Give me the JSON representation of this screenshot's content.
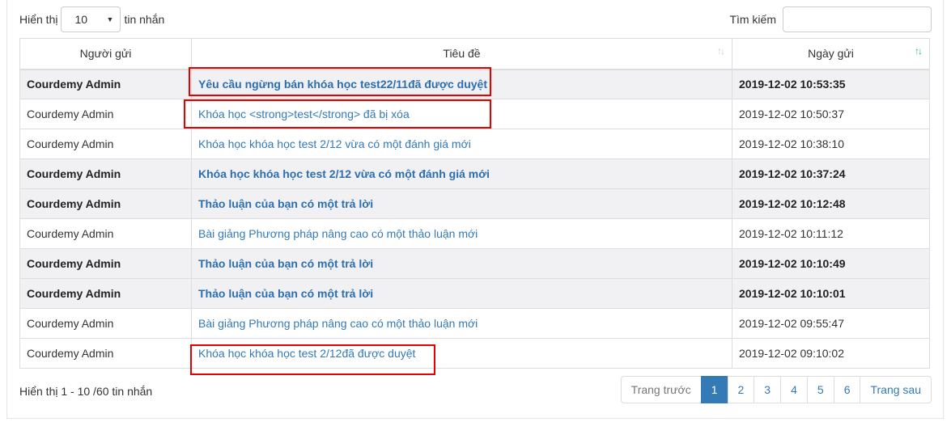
{
  "length_menu": {
    "prefix": "Hiển thị",
    "value": "10",
    "suffix": "tin nhắn"
  },
  "search": {
    "label": "Tìm kiếm",
    "value": "",
    "placeholder": ""
  },
  "table": {
    "columns": [
      "Người gửi",
      "Tiêu đề",
      "Ngày gửi"
    ],
    "rows": [
      {
        "sender": "Courdemy Admin",
        "subject": "Yêu cầu ngừng bán khóa học test22/11đã được duyệt",
        "date": "2019-12-02 10:53:35",
        "unread": true
      },
      {
        "sender": "Courdemy Admin",
        "subject": "Khóa học <strong>test</strong> đã bị xóa",
        "date": "2019-12-02 10:50:37",
        "unread": false
      },
      {
        "sender": "Courdemy Admin",
        "subject": "Khóa học khóa học test 2/12 vừa có một đánh giá mới",
        "date": "2019-12-02 10:38:10",
        "unread": false
      },
      {
        "sender": "Courdemy Admin",
        "subject": "Khóa học khóa học test 2/12 vừa có một đánh giá mới",
        "date": "2019-12-02 10:37:24",
        "unread": true
      },
      {
        "sender": "Courdemy Admin",
        "subject": "Thảo luận của bạn có một trả lời",
        "date": "2019-12-02 10:12:48",
        "unread": true
      },
      {
        "sender": "Courdemy Admin",
        "subject": "Bài giảng Phương pháp nâng cao có một thảo luận mới",
        "date": "2019-12-02 10:11:12",
        "unread": false
      },
      {
        "sender": "Courdemy Admin",
        "subject": "Thảo luận của bạn có một trả lời",
        "date": "2019-12-02 10:10:49",
        "unread": true
      },
      {
        "sender": "Courdemy Admin",
        "subject": "Thảo luận của bạn có một trả lời",
        "date": "2019-12-02 10:10:01",
        "unread": true
      },
      {
        "sender": "Courdemy Admin",
        "subject": "Bài giảng Phương pháp nâng cao có một thảo luận mới",
        "date": "2019-12-02 09:55:47",
        "unread": false
      },
      {
        "sender": "Courdemy Admin",
        "subject": "Khóa học khóa học test 2/12đã được duyệt",
        "date": "2019-12-02 09:10:02",
        "unread": false
      }
    ]
  },
  "info": "Hiển thị 1 - 10 /60 tin nhắn",
  "pagination": {
    "prev": "Trang trước",
    "pages": [
      "1",
      "2",
      "3",
      "4",
      "5",
      "6"
    ],
    "active": "1",
    "next": "Trang sau"
  },
  "colors": {
    "link": "#337ab7",
    "active_page": "#337ab7",
    "highlight_box": "#e60000",
    "unread_row": "#f1f1f4"
  }
}
